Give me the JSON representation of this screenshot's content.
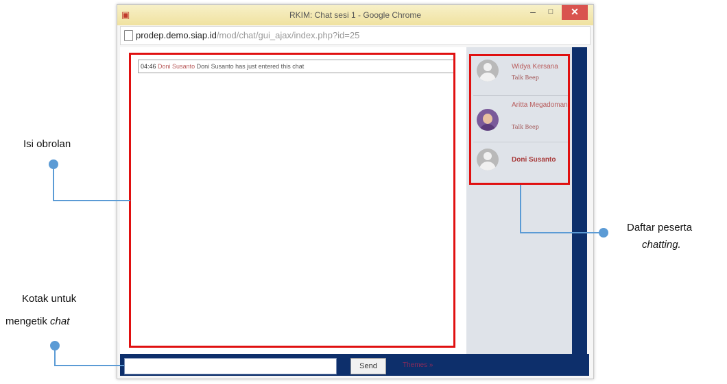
{
  "window": {
    "title": "RKIM: Chat sesi 1 - Google Chrome",
    "url_host": "prodep.demo.siap.id",
    "url_path": "/mod/chat/gui_ajax/index.php?id=25"
  },
  "chat": {
    "messages": [
      {
        "time": "04:46",
        "user": "Doni Susanto",
        "text": "Doni Susanto has just entered this chat"
      }
    ]
  },
  "participants": [
    {
      "name": "Widya Kersana",
      "beep": "Talk Beep",
      "avatar": "default-avatar"
    },
    {
      "name": "Aritta Megadomani",
      "beep": "Talk Beep",
      "avatar": "photo-avatar"
    },
    {
      "name": "Doni Susanto",
      "beep": "",
      "avatar": "default-avatar"
    }
  ],
  "input": {
    "value": "",
    "send_label": "Send",
    "themes_label": "Themes »"
  },
  "annotations": {
    "chat_content": "Isi obrolan",
    "participants_line1": "Daftar peserta",
    "participants_line2": "chatting.",
    "input_line1": "Kotak untuk",
    "input_line2_plain": "mengetik ",
    "input_line2_italic": "chat"
  },
  "colors": {
    "annotation_box": "#e01010",
    "annotation_line": "#5b9bd5",
    "bar": "#0d2f6b"
  }
}
